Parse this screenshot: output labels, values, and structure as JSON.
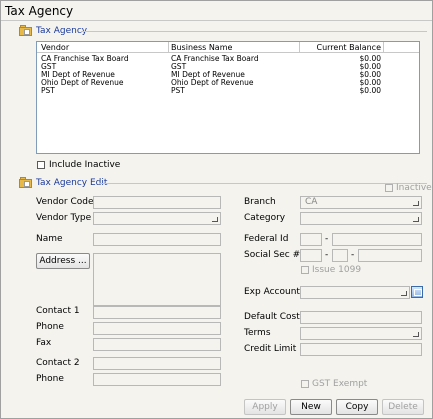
{
  "window": {
    "title": "Tax Agency"
  },
  "list_section": {
    "title": "Tax Agency"
  },
  "table": {
    "columns": [
      "Vendor",
      "Business Name",
      "Current Balance"
    ],
    "rows": [
      [
        "CA Franchise Tax Board",
        "CA Franchise Tax Board",
        "$0.00"
      ],
      [
        "GST",
        "GST",
        "$0.00"
      ],
      [
        "MI Dept of Revenue",
        "MI Dept of Revenue",
        "$0.00"
      ],
      [
        "Ohio Dept of Revenue",
        "Ohio Dept of Revenue",
        "$0.00"
      ],
      [
        "PST",
        "PST",
        "$0.00"
      ]
    ]
  },
  "include_inactive": {
    "label": "Include Inactive",
    "checked": false
  },
  "edit_section": {
    "title": "Tax Agency Edit",
    "inactive_label": "Inactive",
    "labels": {
      "vendor_code": "Vendor Code",
      "vendor_type": "Vendor Type",
      "name": "Name",
      "address_button": "Address ...",
      "contact1": "Contact 1",
      "phone1": "Phone",
      "fax": "Fax",
      "contact2": "Contact 2",
      "phone2": "Phone",
      "branch": "Branch",
      "category": "Category",
      "federal_id": "Federal Id",
      "social_sec": "Social Sec #",
      "issue_1099": "Issue 1099",
      "exp_account": "Exp Account",
      "default_cost": "Default Cost",
      "terms": "Terms",
      "credit_limit": "Credit Limit",
      "gst_exempt": "GST Exempt"
    },
    "values": {
      "branch": "CA",
      "federal_id_sep": "-",
      "ssn_sep1": "-",
      "ssn_sep2": "-"
    }
  },
  "buttons": {
    "apply": "Apply",
    "new": "New",
    "copy": "Copy",
    "delete": "Delete"
  },
  "colors": {
    "section_title": "#1a3a9c",
    "folder": "#e7b84a"
  }
}
